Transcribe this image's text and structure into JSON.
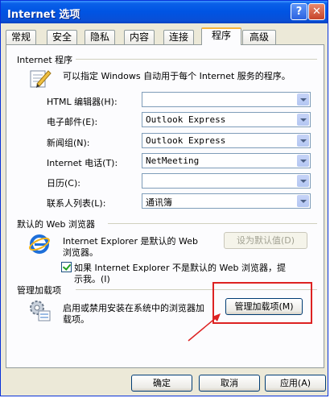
{
  "window": {
    "title": "Internet 选项"
  },
  "titlebar": {
    "help_glyph": "?",
    "close_glyph": "✕"
  },
  "tabs": [
    {
      "label": "常规"
    },
    {
      "label": "安全"
    },
    {
      "label": "隐私"
    },
    {
      "label": "内容"
    },
    {
      "label": "连接"
    },
    {
      "label": "程序"
    },
    {
      "label": "高级"
    }
  ],
  "programs_group": {
    "title": "Internet 程序",
    "description": "可以指定 Windows 自动用于每个 Internet 服务的程序。",
    "rows": [
      {
        "label": "HTML 编辑器(H):",
        "value": ""
      },
      {
        "label": "电子邮件(E):",
        "value": "Outlook Express"
      },
      {
        "label": "新闻组(N):",
        "value": "Outlook Express"
      },
      {
        "label": "Internet 电话(T):",
        "value": "NetMeeting"
      },
      {
        "label": "日历(C):",
        "value": ""
      },
      {
        "label": "联系人列表(L):",
        "value": "通讯簿"
      }
    ]
  },
  "default_browser": {
    "title": "默认的 Web 浏览器",
    "status_line1": "Internet Explorer 是默认的 Web",
    "status_line2": "浏览器。",
    "set_default_button": "设为默认值(D)",
    "check_line1": "如果 Internet Explorer 不是默认的 Web 浏览器，提",
    "check_line2": "示我。(I)"
  },
  "addons": {
    "title": "管理加载项",
    "description_line1": "启用或禁用安装在系统中的浏览器加",
    "description_line2": "载项。",
    "button": "管理加载项(M)"
  },
  "footer": {
    "ok": "确定",
    "cancel": "取消",
    "apply": "应用(A)"
  },
  "colors": {
    "title_bar": "#0054e3",
    "active_tab_accent": "#f8b53c",
    "annotation": "#dd2222"
  }
}
